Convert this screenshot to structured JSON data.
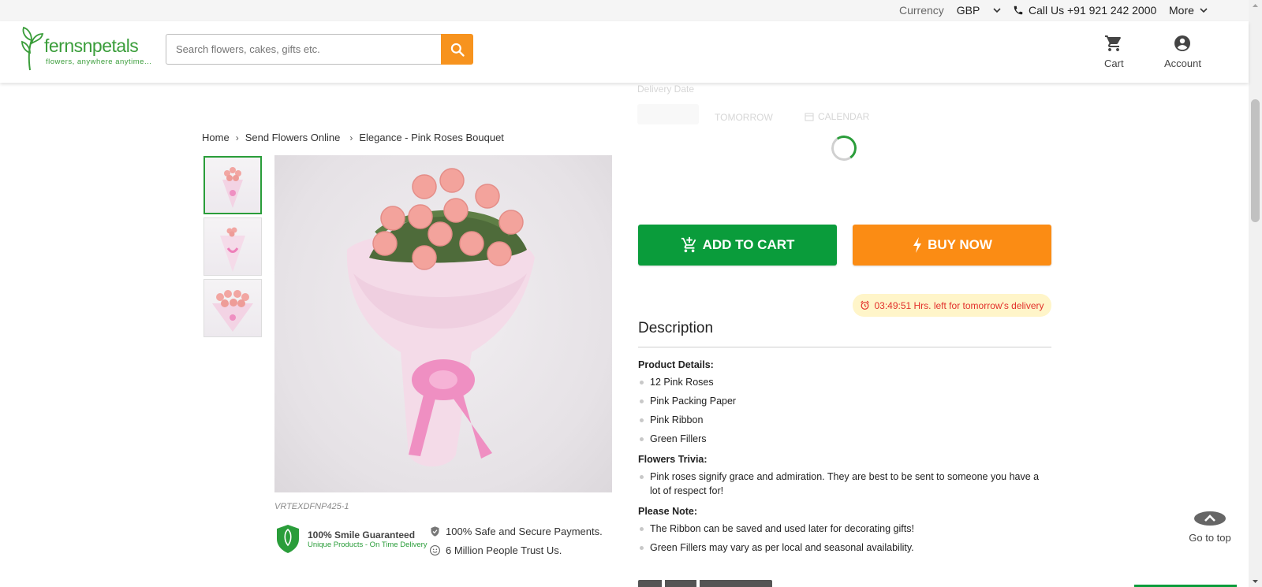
{
  "topbar": {
    "currency_label": "Currency",
    "currency_value": "GBP",
    "call_label": "Call Us +91 921 242 2000",
    "more_label": "More"
  },
  "header": {
    "brand_name": "fernsnpetals",
    "brand_tagline": "flowers, anywhere anytime...",
    "search_placeholder": "Search flowers, cakes, gifts etc.",
    "cart_label": "Cart",
    "account_label": "Account"
  },
  "delivery_faded": {
    "date_label": "Delivery Date",
    "tomorrow_label": "TOMORROW",
    "calendar_label": "CALENDAR"
  },
  "breadcrumb": {
    "items": [
      "Home",
      "Send Flowers Online",
      "Elegance - Pink Roses Bouquet"
    ]
  },
  "product": {
    "sku": "VRTEXDFNP425-1",
    "guarantee_title": "100% Smile Guaranteed",
    "guarantee_sub": "Unique Products - On Time Delivery",
    "trust_1": "100% Safe and Secure Payments.",
    "trust_2": "6 Million People Trust Us."
  },
  "actions": {
    "add_to_cart": "ADD TO CART",
    "buy_now": "BUY NOW",
    "timer_text": "03:49:51 Hrs. left for tomorrow's delivery"
  },
  "description": {
    "title": "Description",
    "sections": [
      {
        "heading": "Product Details:",
        "items": [
          "12 Pink Roses",
          "Pink Packing Paper",
          "Pink Ribbon",
          "Green Fillers"
        ]
      },
      {
        "heading": "Flowers Trivia:",
        "items": [
          "Pink roses signify grace and admiration. They are best to be sent to someone you have a lot of respect for!"
        ]
      },
      {
        "heading": "Please Note:",
        "items": [
          "The Ribbon can be saved and used later for decorating gifts!",
          "Green Fillers may vary as per local and seasonal availability."
        ]
      }
    ]
  },
  "go_to_top_label": "Go to top",
  "colors": {
    "brand_green": "#0a9c3b",
    "accent_orange": "#fb8c14",
    "timer_bg": "#fff5c9",
    "timer_text": "#e2302b"
  }
}
